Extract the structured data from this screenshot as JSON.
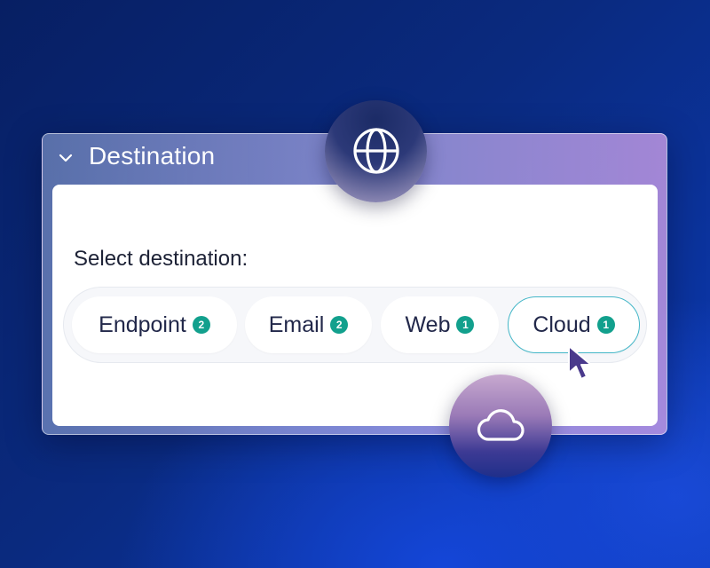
{
  "panel": {
    "title": "Destination",
    "select_label": "Select destination:"
  },
  "destinations": [
    {
      "label": "Endpoint",
      "count": "2",
      "selected": false
    },
    {
      "label": "Email",
      "count": "2",
      "selected": false
    },
    {
      "label": "Web",
      "count": "1",
      "selected": false
    },
    {
      "label": "Cloud",
      "count": "1",
      "selected": true
    }
  ],
  "icons": {
    "header": "chevron-down-icon",
    "top": "globe-icon",
    "bottom": "cloud-icon",
    "pointer": "mouse-cursor-icon"
  },
  "colors": {
    "badge": "#12a08d",
    "selected_border": "#45b7c8",
    "cursor": "#4a3a8c"
  }
}
